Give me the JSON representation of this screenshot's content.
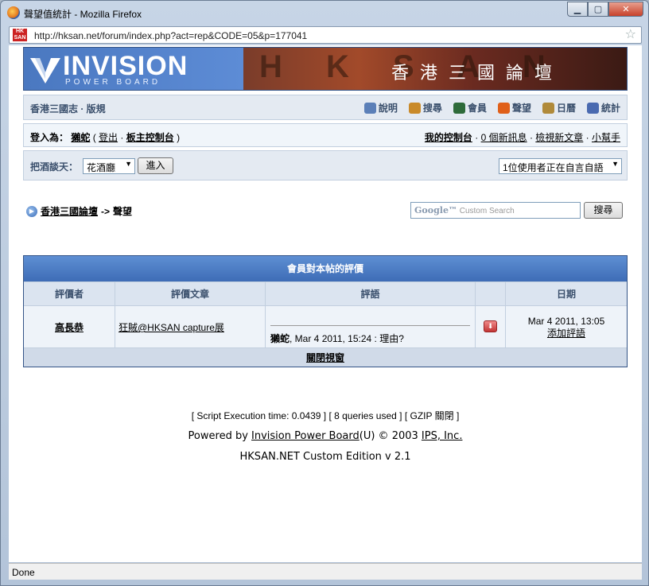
{
  "window": {
    "title": "聲望值統計 - Mozilla Firefox",
    "url": "http://hksan.net/forum/index.php?act=rep&CODE=05&p=177041",
    "site_icon": "HK SAN",
    "status": "Done"
  },
  "banner": {
    "logo_main": "INVISION",
    "logo_sub": "POWER BOARD",
    "ghost": "H K S A N",
    "title_cn": "香港三國論壇"
  },
  "nav": {
    "board_title": "香港三國志 · 版規",
    "items": [
      {
        "label": "說明",
        "icon": "help-icon",
        "color": "#5b7fb8"
      },
      {
        "label": "搜尋",
        "icon": "search-icon",
        "color": "#c98a2a"
      },
      {
        "label": "會員",
        "icon": "members-icon",
        "color": "#2e6b3a"
      },
      {
        "label": "聲望",
        "icon": "heart-icon",
        "color": "#e0601a"
      },
      {
        "label": "日曆",
        "icon": "calendar-icon",
        "color": "#b08a3a"
      },
      {
        "label": "統計",
        "icon": "stats-icon",
        "color": "#4a6ab0"
      }
    ]
  },
  "userbar": {
    "logged_in_label": "登入為：",
    "username": "獺蛇",
    "logout": "登出",
    "mod_cp": "板主控制台",
    "my_cp": "我的控制台",
    "new_messages": "0 個新訊息",
    "view_new": "檢視新文章",
    "helper": "小幫手"
  },
  "chat": {
    "label": "把酒談天：",
    "room_value": "花酒廳",
    "enter_button": "進入",
    "online_value": "1位使用者正在自言自語"
  },
  "breadcrumb": {
    "forum": "香港三國論壇",
    "separator": "->",
    "current": "聲望"
  },
  "search": {
    "placeholder": "Custom Search",
    "brand": "Google™",
    "button": "搜尋"
  },
  "rating": {
    "title": "會員對本帖的評價",
    "columns": [
      "評價者",
      "評價文章",
      "評語",
      "",
      "日期"
    ],
    "rows": [
      {
        "rater": "高長恭",
        "article": "狂賊@HKSAN capture展",
        "comment_user": "獺蛇",
        "comment_text": ", Mar 4 2011, 15:24 : 理由?",
        "date": "Mar 4 2011, 13:05",
        "add_comment": "添加評語"
      }
    ],
    "close": "關閉視窗"
  },
  "footer": {
    "execution": "[ Script Execution time: 0.0439 ]  [ 8 queries used ]  [ GZIP 關閉 ]",
    "powered_prefix": "Powered by ",
    "powered_link": "Invision Power Board",
    "powered_mid": "(U) © 2003  ",
    "ips_link": "IPS, Inc.",
    "edition": "HKSAN.NET Custom Edition v 2.1"
  }
}
